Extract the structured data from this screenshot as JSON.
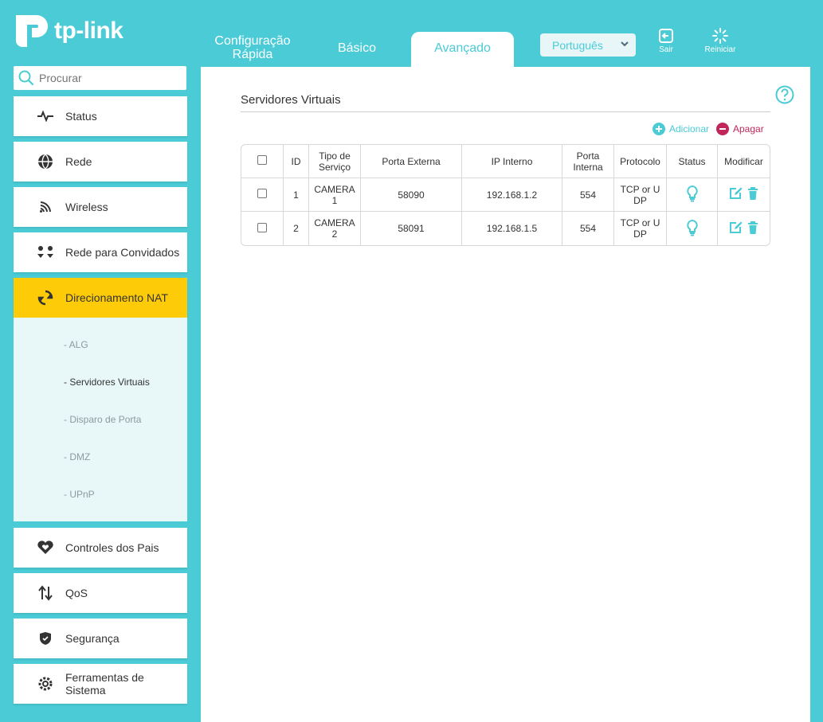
{
  "brand": {
    "logo_text": "tp-link"
  },
  "tabs": [
    {
      "label": "Configuração Rápida"
    },
    {
      "label": "Básico"
    },
    {
      "label": "Avançado",
      "active": true
    }
  ],
  "header": {
    "language": "Português",
    "logout_label": "Sair",
    "reboot_label": "Reiniciar"
  },
  "search": {
    "placeholder": "Procurar"
  },
  "sidebar": {
    "items": [
      {
        "label": "Status",
        "icon": "pulse-icon"
      },
      {
        "label": "Rede",
        "icon": "globe-icon"
      },
      {
        "label": "Wireless",
        "icon": "wifi-icon"
      },
      {
        "label": "Rede para Convidados",
        "icon": "guests-icon"
      },
      {
        "label": "Direcionamento NAT",
        "icon": "nat-icon",
        "active": true
      },
      {
        "label": "Controles dos Pais",
        "icon": "heart-icon"
      },
      {
        "label": "QoS",
        "icon": "qos-icon"
      },
      {
        "label": "Segurança",
        "icon": "shield-icon"
      },
      {
        "label": "Ferramentas de Sistema",
        "icon": "gear-icon"
      }
    ],
    "subitems": [
      {
        "label": "- ALG"
      },
      {
        "label": "- Servidores Virtuais",
        "active": true
      },
      {
        "label": "- Disparo de Porta"
      },
      {
        "label": "- DMZ"
      },
      {
        "label": "- UPnP"
      }
    ]
  },
  "main": {
    "title": "Servidores Virtuais",
    "add_label": "Adicionar",
    "delete_label": "Apagar",
    "table": {
      "headers": [
        "ID",
        "Tipo de Serviço",
        "Porta Externa",
        "IP Interno",
        "Porta Interna",
        "Protocolo",
        "Status",
        "Modificar"
      ],
      "rows": [
        {
          "id": "1",
          "service": "CAMERA 1",
          "ext_port": "58090",
          "ip": "192.168.1.2",
          "int_port": "554",
          "protocol": "TCP or UDP"
        },
        {
          "id": "2",
          "service": "CAMERA 2",
          "ext_port": "58091",
          "ip": "192.168.1.5",
          "int_port": "554",
          "protocol": "TCP or UDP"
        }
      ]
    }
  },
  "colors": {
    "accent": "#4acbd6",
    "active_nav": "#fdcb07",
    "danger": "#c0265a"
  }
}
